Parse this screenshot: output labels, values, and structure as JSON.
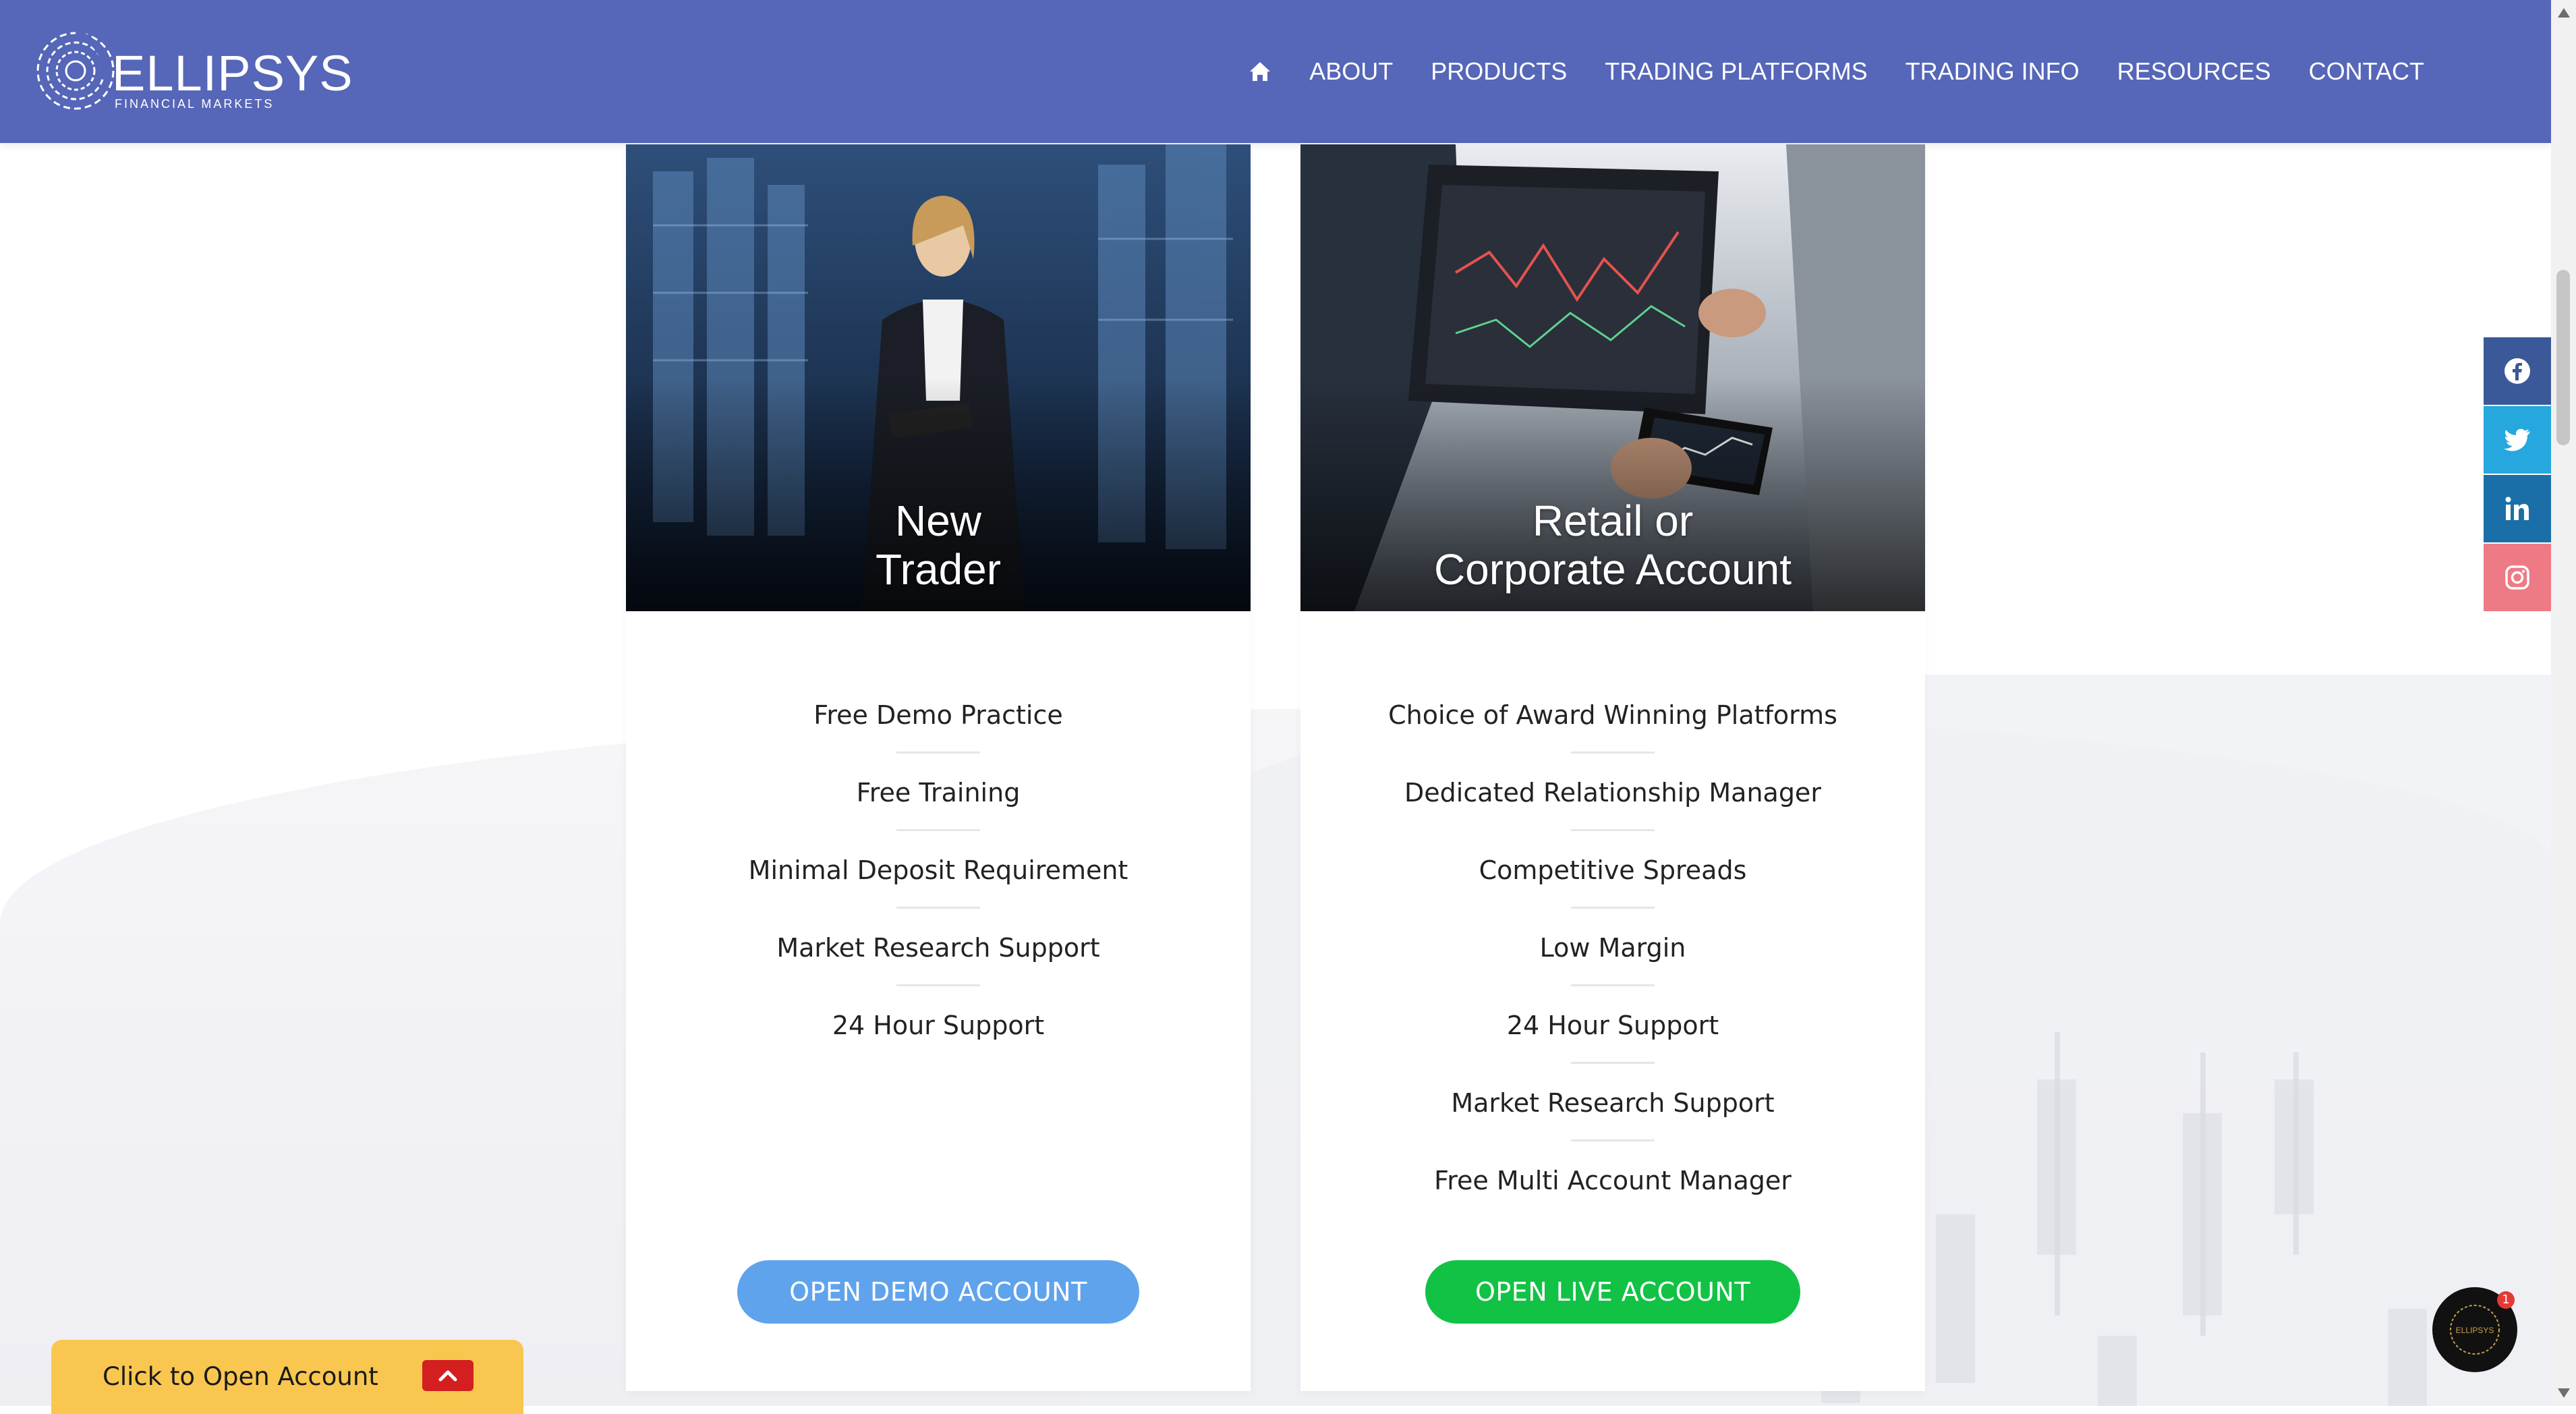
{
  "header": {
    "logo_text": "ELLIPSYS",
    "logo_subtext": "FINANCIAL MARKETS",
    "nav": [
      {
        "label": "ABOUT"
      },
      {
        "label": "PRODUCTS"
      },
      {
        "label": "TRADING PLATFORMS"
      },
      {
        "label": "TRADING INFO"
      },
      {
        "label": "RESOURCES"
      },
      {
        "label": "CONTACT"
      }
    ]
  },
  "cards": [
    {
      "title_line1": "New",
      "title_line2": "Trader",
      "features": [
        "Free Demo Practice",
        "Free Training",
        "Minimal Deposit Requirement",
        "Market Research Support",
        "24 Hour Support"
      ],
      "cta": "OPEN DEMO ACCOUNT",
      "cta_color": "#5fa3ec"
    },
    {
      "title_line1": "Retail or",
      "title_line2": "Corporate Account",
      "features": [
        "Choice of Award Winning Platforms",
        "Dedicated Relationship Manager",
        "Competitive Spreads",
        "Low Margin",
        "24 Hour Support",
        "Market Research Support",
        "Free Multi Account Manager"
      ],
      "cta": "OPEN LIVE ACCOUNT",
      "cta_color": "#12c245"
    }
  ],
  "social": [
    "facebook-icon",
    "twitter-icon",
    "linkedin-icon",
    "instagram-icon"
  ],
  "open_account_bar": {
    "label": "Click to Open Account"
  },
  "chat": {
    "badge": "1",
    "logo_text": "ELLIPSYS"
  },
  "colors": {
    "header_bg": "#5666b8",
    "open_bar_bg": "#f9c74f",
    "open_bar_btn": "#d31f1f"
  }
}
